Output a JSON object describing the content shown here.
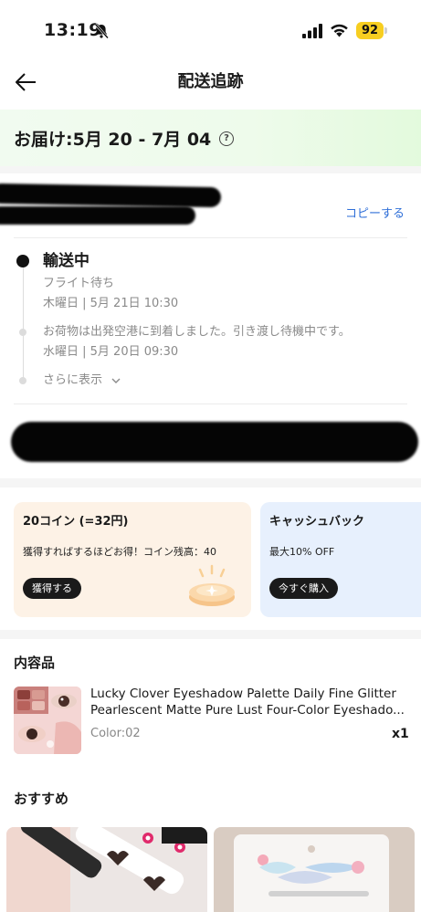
{
  "status_bar": {
    "time": "13:19",
    "battery": "92"
  },
  "nav": {
    "title": "配送追跡"
  },
  "delivery": {
    "estimate": "お届け:5月 20 - 7月 04"
  },
  "tracking": {
    "copy_label": "コピーする",
    "current_status": "輸送中",
    "current_detail": "フライト待ち",
    "current_time": "木曜日 | 5月 21日 10:30",
    "prev_message": "お荷物は出発空港に到着しました。引き渡し待機中です。",
    "prev_time": "水曜日 | 5月 20日 09:30",
    "show_more": "さらに表示"
  },
  "promos": {
    "coin": {
      "title": "20コイン (=32円)",
      "desc": "獲得すればするほどお得！コイン残高：40",
      "button": "獲得する"
    },
    "cashback": {
      "title": "キャッシュバック",
      "desc": "最大10% OFF",
      "button": "今すぐ購入"
    }
  },
  "contents": {
    "title": "内容品",
    "item": {
      "name_line1": "Lucky Clover Eyeshadow Palette Daily Fine Glitter",
      "name_line2": "Pearlescent Matte Pure Lust Four-Color Eyeshado...",
      "variant": "Color:02",
      "quantity": "x1"
    }
  },
  "recommendations": {
    "title": "おすすめ"
  },
  "colors": {
    "link": "#2f6fd8",
    "banner": "#eefbeb",
    "coin_card": "#fdf2e6",
    "cash_card": "#e7f0fd",
    "battery": "#f7ce20"
  }
}
